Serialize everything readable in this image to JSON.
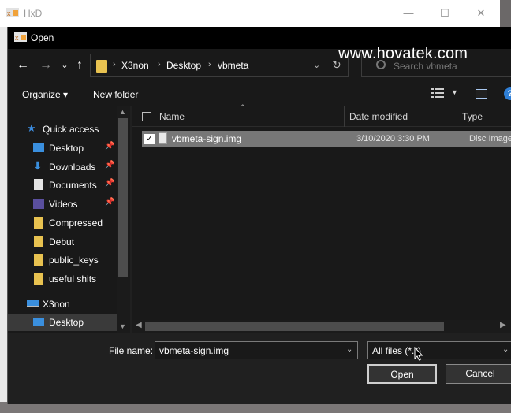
{
  "background_window": {
    "title": "HxD",
    "minimize": "—",
    "maximize": "☐",
    "close": "✕"
  },
  "dialog": {
    "title": "Open"
  },
  "navbar": {
    "back": "←",
    "forward": "→",
    "dropdown": "⌄",
    "up": "↑",
    "breadcrumb": [
      "X3non",
      "Desktop",
      "vbmeta"
    ],
    "search_placeholder": "Search vbmeta"
  },
  "watermark": "www.hovatek.com",
  "toolbar": {
    "organize": "Organize ▾",
    "new_folder": "New folder"
  },
  "nav_pane": {
    "items": [
      {
        "label": "Quick access",
        "icon": "star-icon",
        "pinned": false
      },
      {
        "label": "Desktop",
        "icon": "desktop-icon",
        "pinned": true
      },
      {
        "label": "Downloads",
        "icon": "download-icon",
        "pinned": true
      },
      {
        "label": "Documents",
        "icon": "documents-icon",
        "pinned": true
      },
      {
        "label": "Videos",
        "icon": "videos-icon",
        "pinned": true
      },
      {
        "label": "Compressed",
        "icon": "folder-icon",
        "pinned": false
      },
      {
        "label": "Debut",
        "icon": "folder-icon",
        "pinned": false
      },
      {
        "label": "public_keys",
        "icon": "folder-icon",
        "pinned": false
      },
      {
        "label": "useful shits",
        "icon": "folder-icon",
        "pinned": false
      },
      {
        "label": "X3non",
        "icon": "computer-icon",
        "pinned": false
      },
      {
        "label": "Desktop",
        "icon": "desktop-icon",
        "pinned": false,
        "selected": true
      }
    ]
  },
  "file_list": {
    "columns": [
      "Name",
      "Date modified",
      "Type"
    ],
    "rows": [
      {
        "name": "vbmeta-sign.img",
        "date": "3/10/2020 3:30 PM",
        "type": "Disc Image File",
        "checked": true
      }
    ]
  },
  "bottom": {
    "file_name_label": "File name:",
    "file_name_value": "vbmeta-sign.img",
    "filter_value": "All files (*.*)",
    "open_label": "Open",
    "cancel_label": "Cancel"
  },
  "colors": {
    "dialog_bg": "#202020",
    "pane_bg": "#191919",
    "selected_row": "#777777",
    "folder": "#e8c250",
    "accent": "#2f7fd6"
  }
}
